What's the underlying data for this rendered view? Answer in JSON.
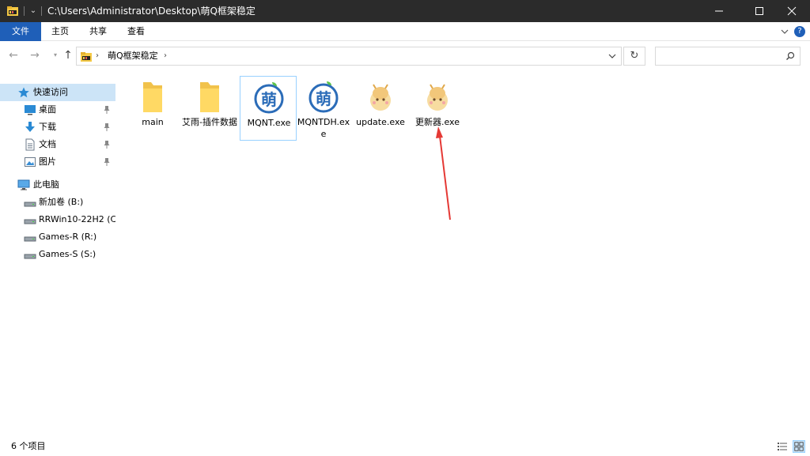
{
  "title_bar": {
    "path": "C:\\Users\\Administrator\\Desktop\\萌Q框架稳定",
    "app_icon": "explorer-folder-icon",
    "buttons": [
      "minimize-icon",
      "maximize-icon",
      "close-icon"
    ]
  },
  "ribbon": {
    "tabs": [
      {
        "label": "文件",
        "active": true
      },
      {
        "label": "主页"
      },
      {
        "label": "共享"
      },
      {
        "label": "查看"
      }
    ],
    "help_label": "?",
    "accent": "#1f5fb8"
  },
  "address": {
    "breadcrumb": "萌Q框架稳定",
    "search_placeholder": ""
  },
  "sidebar": {
    "quick_access": {
      "label": "快速访问"
    },
    "pinned": [
      {
        "label": "桌面",
        "icon": "desktop-icon"
      },
      {
        "label": "下载",
        "icon": "download-icon"
      },
      {
        "label": "文档",
        "icon": "document-icon"
      },
      {
        "label": "图片",
        "icon": "picture-icon"
      }
    ],
    "this_pc": {
      "label": "此电脑"
    },
    "drives": [
      {
        "label": "新加卷 (B:)"
      },
      {
        "label": "RRWin10-22H2 (C"
      },
      {
        "label": "Games-R (R:)"
      },
      {
        "label": "Games-S (S:)"
      }
    ]
  },
  "files": [
    {
      "name": "main",
      "type": "folder"
    },
    {
      "name": "艾雨-插件数据",
      "type": "folder"
    },
    {
      "name": "MQNT.exe",
      "type": "meng-app",
      "selected": true
    },
    {
      "name": "MQNTDH.exe",
      "type": "meng-app"
    },
    {
      "name": "update.exe",
      "type": "mascot-app"
    },
    {
      "name": "更新器.exe",
      "type": "mascot-app"
    }
  ],
  "status": {
    "item_count": "6 个项目"
  },
  "colors": {
    "titlebar": "#2b2b2b",
    "selection": "#cce4f7",
    "annotation_arrow": "#e53935"
  }
}
